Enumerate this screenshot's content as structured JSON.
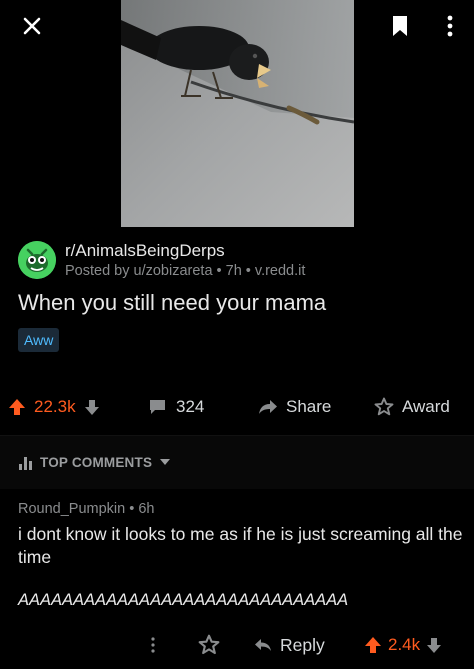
{
  "post": {
    "subreddit": "r/AnimalsBeingDerps",
    "meta": "Posted by u/zobizareta • 7h • v.redd.it",
    "title": "When you still need your mama",
    "flair": "Aww",
    "upvotes": "22.3k",
    "comments": "324",
    "share_label": "Share",
    "award_label": "Award"
  },
  "comments_section": {
    "sort_label": "TOP COMMENTS"
  },
  "comment": {
    "author_meta": "Round_Pumpkin • 6h",
    "body": "i dont know it looks to me as if he is just screaming all the time",
    "shout": "AAAAAAAAAAAAAAAAAAAAAAAAAAAAAA",
    "reply_label": "Reply",
    "upvotes": "2.4k"
  },
  "colors": {
    "upvote": "#ff5b1f",
    "flair_text": "#4fbcff",
    "avatar": "#46d160"
  },
  "icons": [
    "close-icon",
    "bookmark-icon",
    "more-vertical-icon",
    "upvote-icon",
    "downvote-icon",
    "comment-icon",
    "share-icon",
    "award-icon",
    "sort-icon",
    "chevron-down-icon",
    "reply-icon"
  ]
}
